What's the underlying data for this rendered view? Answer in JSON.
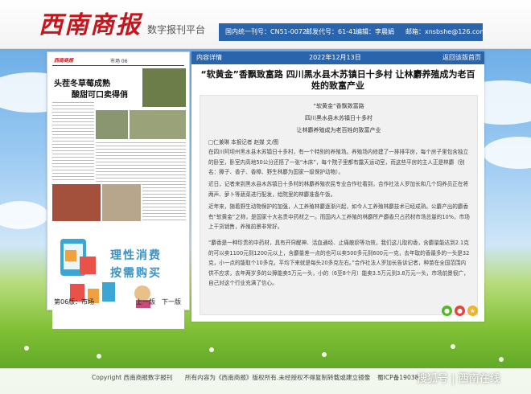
{
  "site": {
    "logo": "西南商报",
    "platform_label": "数字报刊平台",
    "cn_label": "国内统一刊号：CN51-0072",
    "post_label": "邮发代号：61-41",
    "editor_label": "编辑：李晨娟",
    "email_label": "邮箱：xnsbshe@126.com"
  },
  "paper": {
    "masthead": "西南商报",
    "section_tag": "市场 06",
    "headline_1": "头茬冬草莓成熟",
    "headline_2": "酸甜可口卖得俏",
    "ad_line_1": "理性消费",
    "ad_line_2": "按需购买",
    "page_name": "第06版：市场",
    "prev_label": "上一版",
    "next_label": "下一版"
  },
  "article": {
    "breadcrumb": "内容详情",
    "date": "2022年12月13日",
    "back_label": "返回该版首页",
    "title": "“软黄金”香飘致富路 四川黑水县木苏镇日十多村 让林麝养殖成为老百姓的致富产业",
    "sub_1": "“软黄金”香飘致富路",
    "sub_2": "四川黑水县木苏镇日十多村",
    "sub_3": "让林麝养殖成为老百姓的致富产业",
    "byline": "□仁兼琳 本报记者 赵媒 文/图",
    "p1": "在四川阿坝州黑水县木苏镇日十多村，有一个特别的养殖场。养殖场内修建了一排排平房，每个房子里包含独立的卧室，卧室内高地50公分还搭了一张“木床”，每个院子里都有露天运动室，而这些平房的主人正是林麝（别名：獐子、香子、香樟、野生林麝为国家一级保护动物）。",
    "p2": "近日，记者来到黑水县木苏镇日十多村的林麝养殖农民专业合作社看到，合作社法人罗加长和几个饲养员正在将两声、萝卜等蔬菜进行配发，给院里的林麝准备午饭。",
    "p3": "近年来，随着野生动物保护的加强，人工养殖林麝逐渐兴起，如今人工养殖林麝技术已经成熟。公麝产出的麝香有“软黄金”之称，是国家十大名贵中药材之一。而国内人工养殖的林麝所产麝香只占药材市场总量的10%，市场上干货销售，养殖前景非常好。",
    "p4": "“麝香是一种珍贵的中药材，具有开窍醒神、活血通经、止痛散瘀等功效，我们这儿取的香，含麝量能达到2.1克的可以卖1100元到1200元以上，含麝量差一点的也可以卖500多元到600元一克，去年取的香最多的一头是32克，小一点的能取个10多克，平均下来就是每头20多克左右。”合作社法人罗加长告诉记者，种苗在全国范围内供不应求，去年两岁多的公獐能卖5万元一头，小的（6至8个月）能卖3.5万元到3.8万元一头，市场前景很广，自己对这个行业充满了信心。"
  },
  "footer": {
    "copyright": "Copyright 西南商报数字报刊",
    "rights": "所有内容为《西南商报》版权所有.未经授权不得复制转载或建立镜像",
    "icp": "蜀ICP备19038",
    "watermark": "搜狐号 | 西南在线"
  },
  "colors": {
    "brand_red": "#c8151b",
    "nav_blue": "#2a64ad",
    "ad_blue": "#3b92c4"
  },
  "icons": [
    "wechat-icon",
    "weibo-icon",
    "favorite-icon"
  ]
}
